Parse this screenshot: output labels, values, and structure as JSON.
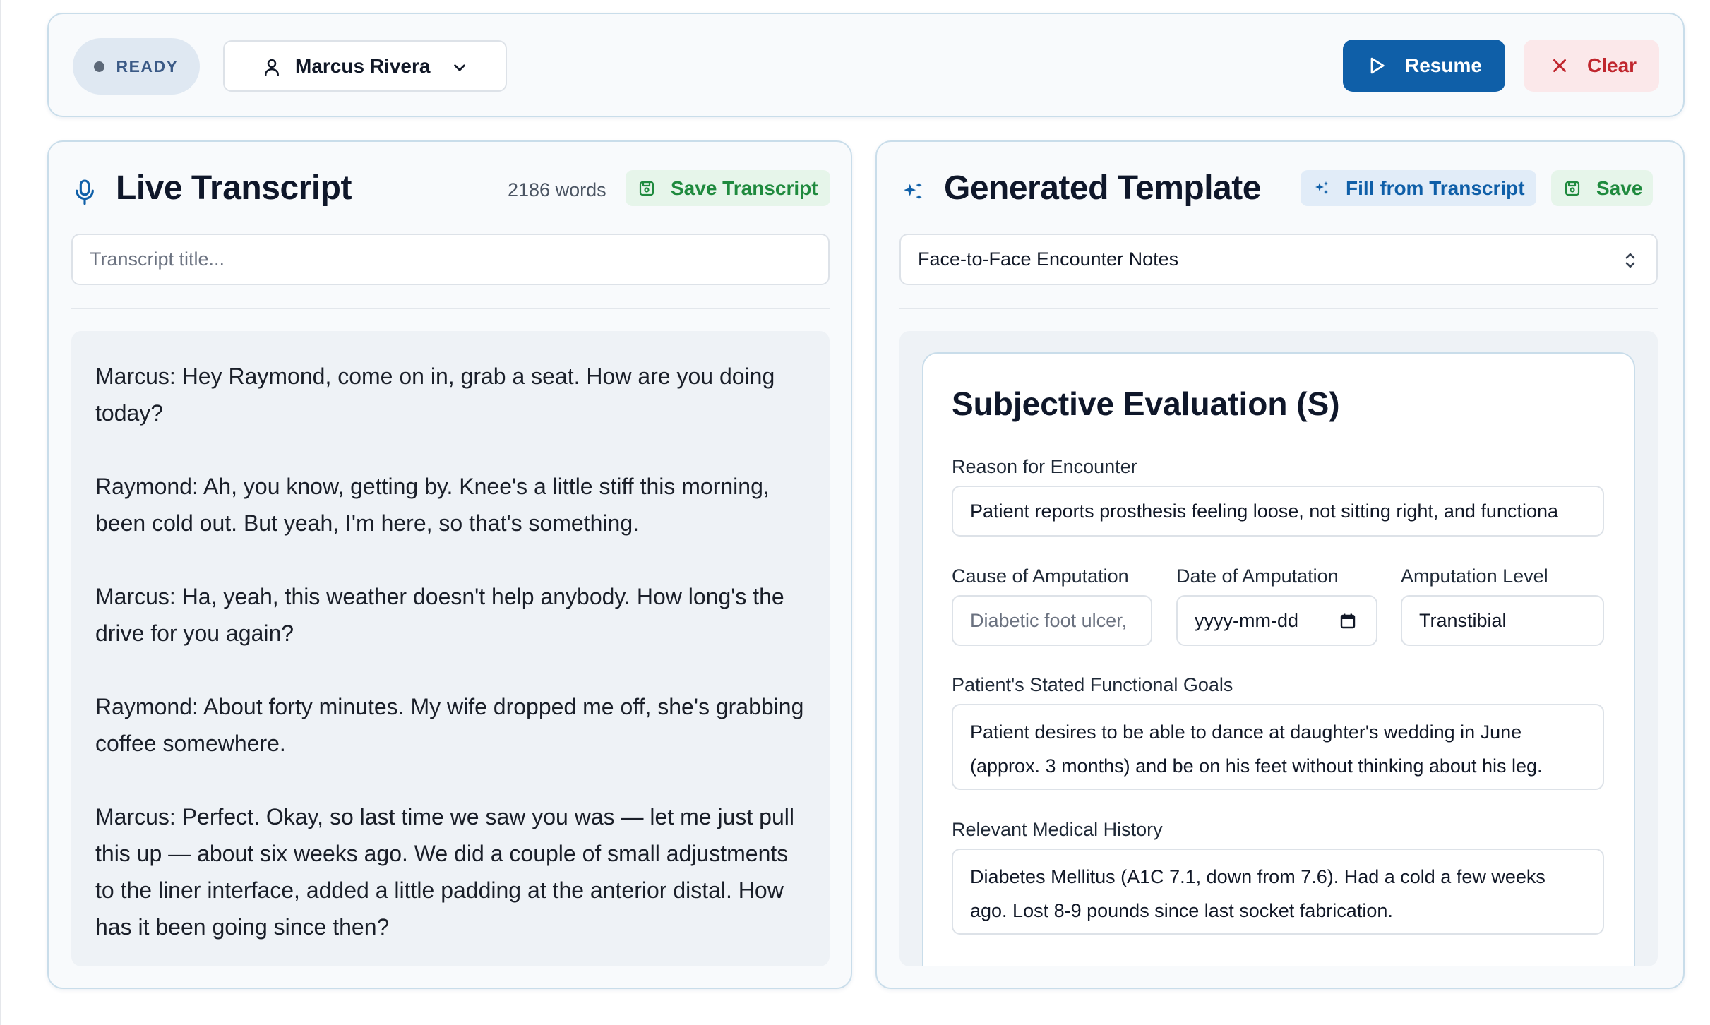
{
  "header": {
    "status": "READY",
    "user_name": "Marcus Rivera",
    "resume_label": "Resume",
    "clear_label": "Clear"
  },
  "transcript": {
    "title": "Live Transcript",
    "word_count": "2186 words",
    "save_label": "Save Transcript",
    "title_placeholder": "Transcript title...",
    "lines": [
      "Marcus: Hey Raymond, come on in, grab a seat. How are you doing today?",
      "Raymond: Ah, you know, getting by. Knee's a little stiff this morning, been cold out. But yeah, I'm here, so that's something.",
      "Marcus: Ha, yeah, this weather doesn't help anybody. How long's the drive for you again?",
      "Raymond: About forty minutes. My wife dropped me off, she's grabbing coffee somewhere.",
      "Marcus: Perfect. Okay, so last time we saw you was — let me just pull this up — about six weeks ago. We did a couple of small adjustments to the liner interface, added a little padding at the anterior distal. How has it been going since then?"
    ]
  },
  "template": {
    "title": "Generated Template",
    "fill_label": "Fill from Transcript",
    "save_label": "Save",
    "selected_template": "Face-to-Face Encounter Notes",
    "section_title": "Subjective Evaluation (S)",
    "fields": {
      "reason_label": "Reason for Encounter",
      "reason_value": "Patient reports prosthesis feeling loose, not sitting right, and functiona",
      "cause_label": "Cause of Amputation",
      "cause_placeholder": "Diabetic foot ulcer,",
      "date_label": "Date of Amputation",
      "date_placeholder": "yyyy-mm-dd",
      "level_label": "Amputation Level",
      "level_value": "Transtibial",
      "goals_label": "Patient's Stated Functional Goals",
      "goals_value": "Patient desires to be able to dance at daughter's wedding in June (approx. 3 months) and be on his feet without thinking about his leg.",
      "history_label": "Relevant Medical History",
      "history_value": "Diabetes Mellitus (A1C 7.1, down from 7.6). Had a cold a few weeks ago. Lost 8-9 pounds since last socket fabrication."
    }
  },
  "colors": {
    "primary": "#0f5fa8",
    "danger": "#c0262e",
    "success": "#1f8a3e",
    "panel_border": "#c9ddea"
  }
}
